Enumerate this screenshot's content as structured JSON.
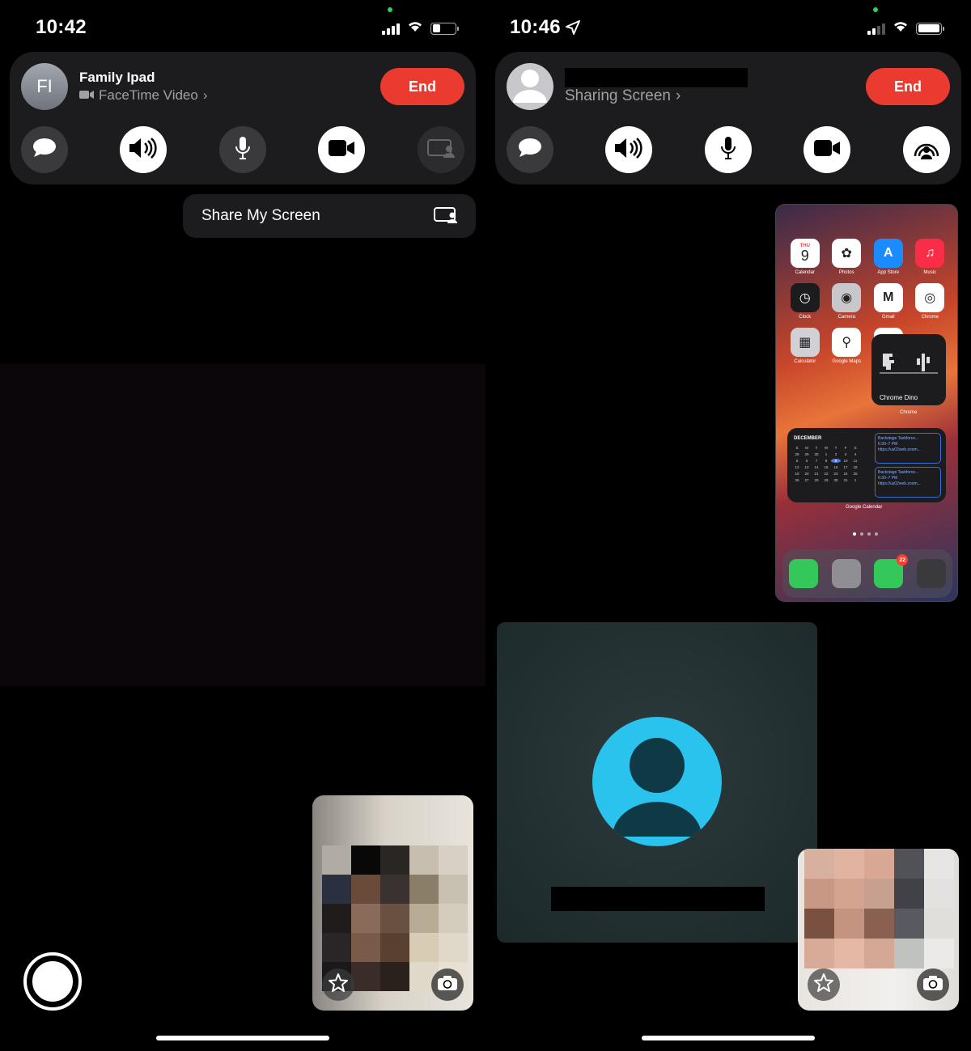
{
  "left": {
    "status": {
      "time": "10:42"
    },
    "call": {
      "avatar_initials": "FI",
      "contact_name": "Family Ipad",
      "subtitle": "FaceTime Video",
      "end_label": "End"
    },
    "controls": [
      "message-icon",
      "speaker-icon",
      "microphone-icon",
      "camera-icon",
      "share-screen-icon"
    ],
    "menu": {
      "share_label": "Share My Screen"
    }
  },
  "right": {
    "status": {
      "time": "10:46"
    },
    "call": {
      "subtitle": "Sharing Screen",
      "end_label": "End"
    },
    "controls": [
      "message-icon",
      "speaker-icon",
      "microphone-icon",
      "camera-icon",
      "shareplay-icon"
    ],
    "shared_screen": {
      "apps": [
        {
          "label": "Calendar",
          "glyph_top": "THU",
          "glyph": "9",
          "color": "#ffffff"
        },
        {
          "label": "Photos",
          "glyph": "✿",
          "color": "#ffffff"
        },
        {
          "label": "App Store",
          "glyph": "A",
          "color": "#1a8cff"
        },
        {
          "label": "Music",
          "glyph": "♫",
          "color": "#fa2d48"
        },
        {
          "label": "Clock",
          "glyph": "◷",
          "color": "#1c1c1e"
        },
        {
          "label": "Camera",
          "glyph": "◉",
          "color": "#c7c7cc"
        },
        {
          "label": "Gmail",
          "glyph": "M",
          "color": "#ffffff"
        },
        {
          "label": "Chrome",
          "glyph": "◎",
          "color": "#ffffff"
        },
        {
          "label": "Calculator",
          "glyph": "▦",
          "color": "#d0d0d5"
        },
        {
          "label": "Google Maps",
          "glyph": "⚲",
          "color": "#ffffff"
        },
        {
          "label": "Notes",
          "glyph": "≡",
          "color": "#ffffff"
        }
      ],
      "dino_widget": {
        "label": "Chrome Dino",
        "app": "Chrome"
      },
      "calendar_widget": {
        "month": "DECEMBER",
        "weekdays": [
          "S",
          "M",
          "T",
          "W",
          "T",
          "F",
          "S"
        ],
        "days": [
          "28",
          "29",
          "30",
          "1",
          "2",
          "3",
          "4",
          "5",
          "6",
          "7",
          "8",
          "9",
          "10",
          "11",
          "12",
          "13",
          "14",
          "15",
          "16",
          "17",
          "18",
          "19",
          "20",
          "21",
          "22",
          "23",
          "24",
          "25",
          "26",
          "27",
          "28",
          "29",
          "30",
          "31",
          "1"
        ],
        "today": "9",
        "events": [
          {
            "title": "Backstage Taskforce...",
            "time": "6:30–7 PM",
            "link": "https://us02web.zoom..."
          },
          {
            "title": "Backstage Taskforce...",
            "time": "6:30–7 PM",
            "link": "https://us02web.zoom..."
          }
        ],
        "label": "Google Calendar"
      },
      "dock": [
        {
          "name": "phone-app-icon",
          "color": "#34c759"
        },
        {
          "name": "settings-app-icon",
          "color": "#8e8e93"
        },
        {
          "name": "messages-app-icon",
          "color": "#34c759",
          "badge": "22"
        },
        {
          "name": "folder-app-icon",
          "color": "#3a3a3c"
        }
      ]
    }
  },
  "colors": {
    "end_red": "#eb3b30",
    "panel": "#1c1c1e",
    "avatar_blue": "#2ac3ee"
  }
}
